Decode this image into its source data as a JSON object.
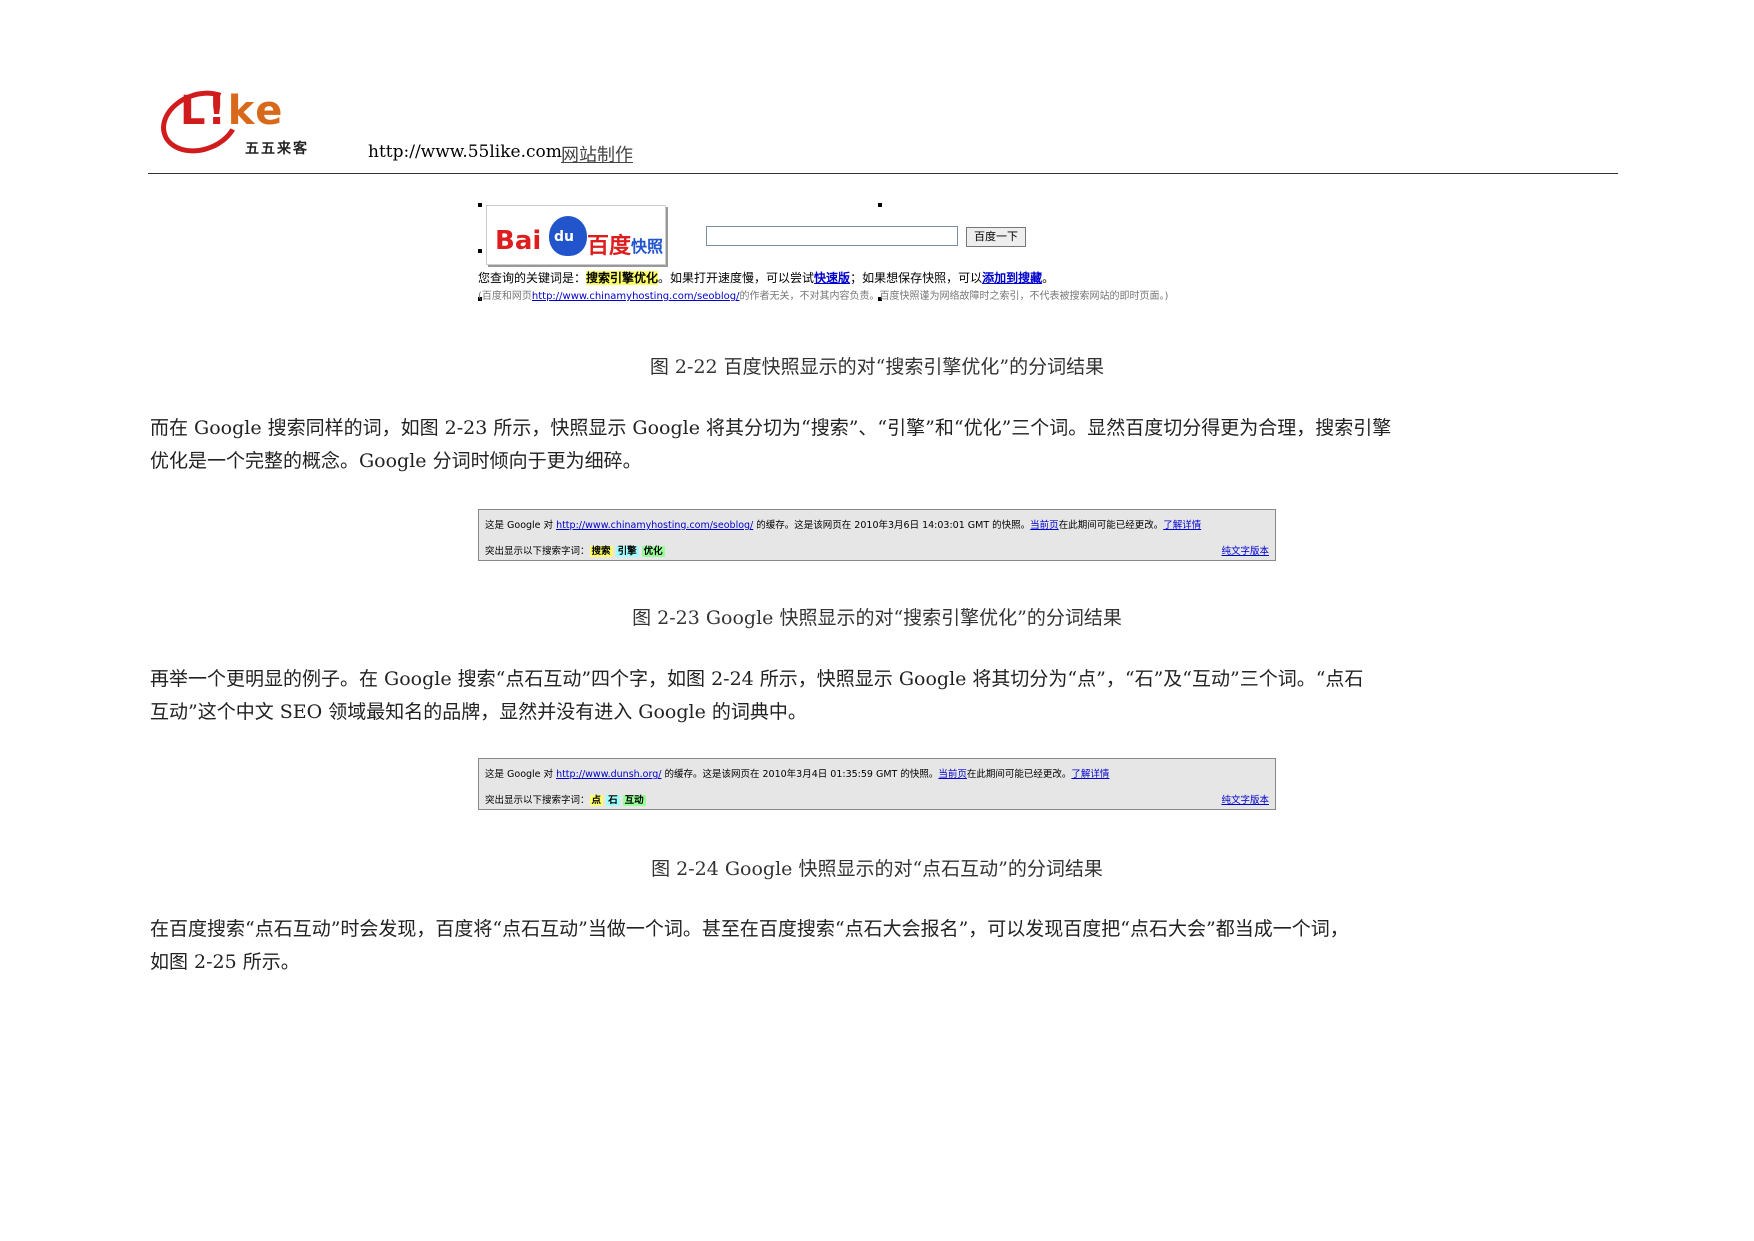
{
  "header": {
    "logo_word_l": "L",
    "logo_word_i": "!",
    "logo_word_ke": "ke",
    "logo_sub": "五五来客",
    "url": "http://www.55like.com",
    "link": "网站制作"
  },
  "baidu": {
    "logo_bai": "Bai",
    "logo_du": "du",
    "logo_cn": "百度",
    "logo_kz": "快照",
    "button": "百度一下",
    "line1_prefix": "您查询的关键词是：",
    "line1_kw": "搜索引擎优化",
    "line1_mid": "。如果打开速度慢，可以尝试",
    "line1_link1": "快速版",
    "line1_mid2": "；如果想保存快照，可以",
    "line1_link2": "添加到搜藏",
    "line1_end": "。",
    "line2_prefix": "(百度和网页",
    "line2_link": "http://www.chinamyhosting.com/seoblog/",
    "line2_end": "的作者无关，不对其内容负责。百度快照谨为网络故障时之索引，不代表被搜索网站的即时页面。)"
  },
  "captions": {
    "fig22": "图 2-22 百度快照显示的对“搜索引擎优化”的分词结果",
    "fig23": "图 2-23 Google 快照显示的对“搜索引擎优化”的分词结果",
    "fig24": "图 2-24 Google 快照显示的对“点石互动”的分词结果"
  },
  "paragraphs": {
    "p1_l1": "而在 Google 搜索同样的词，如图 2-23 所示，快照显示 Google 将其分切为“搜索”、“引擎”和“优化”三个词。显然百度切分得更为合理，搜索引擎",
    "p1_l2": "优化是一个完整的概念。Google 分词时倾向于更为细碎。",
    "p2_l1": "再举一个更明显的例子。在 Google 搜索“点石互动”四个字，如图 2-24 所示，快照显示 Google 将其切分为“点”，“石”及“互动”三个词。“点石",
    "p2_l2": "互动”这个中文 SEO 领域最知名的品牌，显然并没有进入 Google 的词典中。",
    "p3_l1": "在百度搜索“点石互动”时会发现，百度将“点石互动”当做一个词。甚至在百度搜索“点石大会报名”，可以发现百度把“点石大会”都当成一个词，",
    "p3_l2": "如图 2-25 所示。"
  },
  "google1": {
    "prefix": "这是 Google 对 ",
    "url": "http://www.chinamyhosting.com/seoblog/",
    "mid": " 的缓存。这是该网页在 2010年3月6日 14:03:01 GMT 的快照。",
    "current": "当前页",
    "mid2": "在此期间可能已经更改。",
    "details": "了解详情",
    "terms_label": "突出显示以下搜索字词：",
    "terms": [
      "搜索",
      "引擎",
      "优化"
    ],
    "plain": "纯文字版本"
  },
  "google2": {
    "prefix": "这是 Google 对 ",
    "url": "http://www.dunsh.org/",
    "mid": " 的缓存。这是该网页在 2010年3月4日 01:35:59 GMT 的快照。",
    "current": "当前页",
    "mid2": "在此期间可能已经更改。",
    "details": "了解详情",
    "terms_label": "突出显示以下搜索字词：",
    "terms": [
      "点",
      "石",
      "互动"
    ],
    "plain": "纯文字版本"
  }
}
